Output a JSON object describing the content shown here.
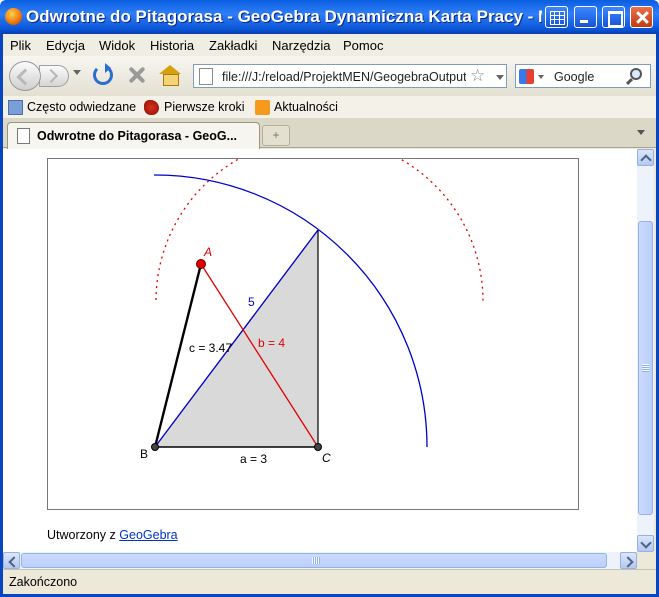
{
  "window": {
    "title": "Odwrotne do Pitagorasa - GeoGebra Dynamiczna Karta Pracy - Mozilla Firefox"
  },
  "menu": {
    "items": [
      "Plik",
      "Edycja",
      "Widok",
      "Historia",
      "Zakładki",
      "Narzędzia",
      "Pomoc"
    ]
  },
  "navbar": {
    "url": "file:///J:/reload/ProjektMEN/GeogebraOutput/odwrotne_do_pitagorasa.html",
    "search_engine": "Google",
    "search_placeholder": "Google"
  },
  "bookmarks": {
    "items": [
      "Często odwiedzane",
      "Pierwsze kroki",
      "Aktualności"
    ]
  },
  "tabs": {
    "active_title": "Odwrotne do Pitagorasa - GeoG...",
    "new_tab_symbol": "+"
  },
  "applet": {
    "labels": {
      "point_a": "A",
      "point_b": "B",
      "point_c": "C",
      "side_a": "a = 3",
      "side_b": "b = 4",
      "side_c": "c = 3.47",
      "radius": "5"
    },
    "colors": {
      "arc": "#0000cc",
      "hypotenuse": "#0000cc",
      "side_b": "#e00000",
      "dotted_circle": "#e00000",
      "triangle_fill": "#d9d9d9",
      "side_c": "#000000",
      "point_a": "#e00000"
    }
  },
  "footer": {
    "created_prefix": "Utworzony z",
    "link_text": "GeoGebra"
  },
  "status": {
    "text": "Zakończono"
  }
}
